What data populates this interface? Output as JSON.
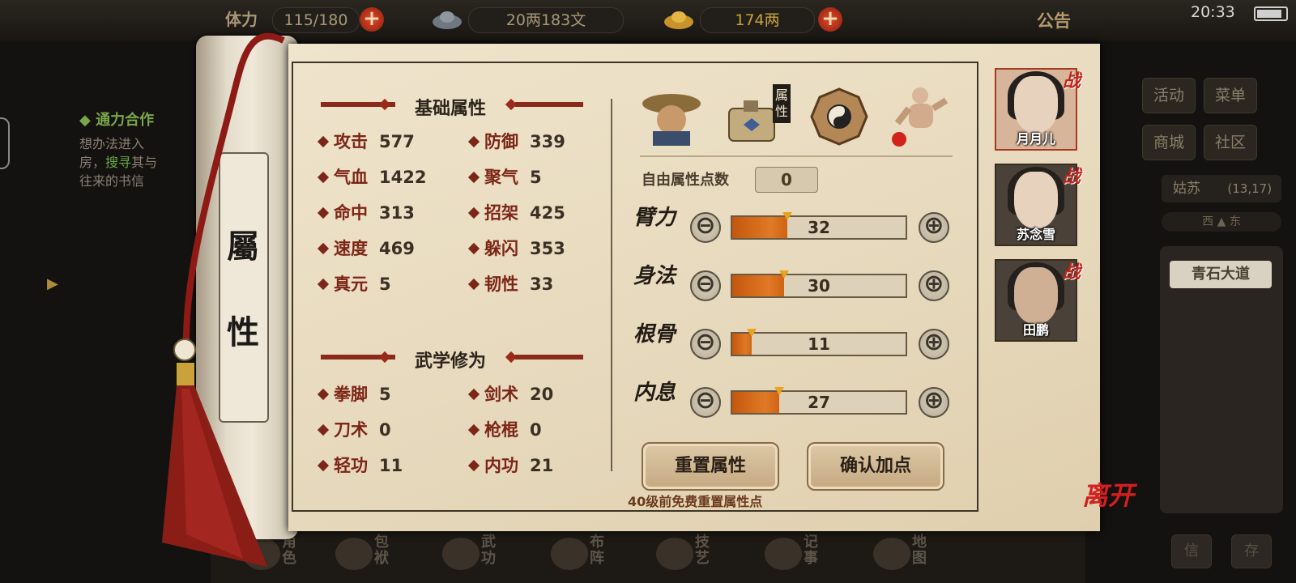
{
  "topbar": {
    "stamina_label": "体力",
    "stamina": "115/180",
    "copper": "20两183文",
    "gold": "174两",
    "notice": "公告",
    "clock": "20:33"
  },
  "quest": {
    "title": "◆ 通力合作",
    "line1": "想办法进入",
    "line2_a": "房，",
    "line2_b": "搜寻",
    "line2_c": "其与",
    "line3": "往来的书信"
  },
  "side_menu": {
    "activity": "活动",
    "menu": "菜单",
    "shop": "商城",
    "community": "社区",
    "location": "姑苏",
    "coords": "(13,17)",
    "compass": "西 ▲ 东",
    "place": "青石大道",
    "mail": "信",
    "save": "存"
  },
  "bottom_nav": [
    {
      "label": "角色"
    },
    {
      "label": "包袱"
    },
    {
      "label": "武功"
    },
    {
      "label": "布阵"
    },
    {
      "label": "技艺"
    },
    {
      "label": "记事"
    },
    {
      "label": "地图"
    }
  ],
  "scroll": {
    "char1": "屬",
    "char2": "性"
  },
  "basic": {
    "title": "基础属性",
    "stats": [
      {
        "label": "攻击",
        "value": "577"
      },
      {
        "label": "防御",
        "value": "339"
      },
      {
        "label": "气血",
        "value": "1422"
      },
      {
        "label": "聚气",
        "value": "5"
      },
      {
        "label": "命中",
        "value": "313"
      },
      {
        "label": "招架",
        "value": "425"
      },
      {
        "label": "速度",
        "value": "469"
      },
      {
        "label": "躲闪",
        "value": "353"
      },
      {
        "label": "真元",
        "value": "5"
      },
      {
        "label": "韧性",
        "value": "33"
      }
    ]
  },
  "martial": {
    "title": "武学修为",
    "stats": [
      {
        "label": "拳脚",
        "value": "5"
      },
      {
        "label": "剑术",
        "value": "20"
      },
      {
        "label": "刀术",
        "value": "0"
      },
      {
        "label": "枪棍",
        "value": "0"
      },
      {
        "label": "轻功",
        "value": "11"
      },
      {
        "label": "内功",
        "value": "21"
      }
    ]
  },
  "tabs": {
    "attributes_tab_label": "属性"
  },
  "points": {
    "free_label": "自由属性点数",
    "free_value": "0",
    "attrs": [
      {
        "name": "臂力",
        "value": "32",
        "fill": 0.32
      },
      {
        "name": "身法",
        "value": "30",
        "fill": 0.3
      },
      {
        "name": "根骨",
        "value": "11",
        "fill": 0.11
      },
      {
        "name": "内息",
        "value": "27",
        "fill": 0.27
      }
    ],
    "minus": "⊖",
    "plus": "⊕"
  },
  "buttons": {
    "reset": "重置属性",
    "confirm": "确认加点"
  },
  "hint": "40级前免费重置属性点",
  "party": [
    {
      "name": "月月儿",
      "badge": "战"
    },
    {
      "name": "苏念雪",
      "badge": "战"
    },
    {
      "name": "田鹏",
      "badge": "战"
    }
  ],
  "leave": "离开",
  "colors": {
    "accent_red": "#7c2617",
    "bar_orange": "#e07a26",
    "parchment": "#e6d8bb"
  }
}
